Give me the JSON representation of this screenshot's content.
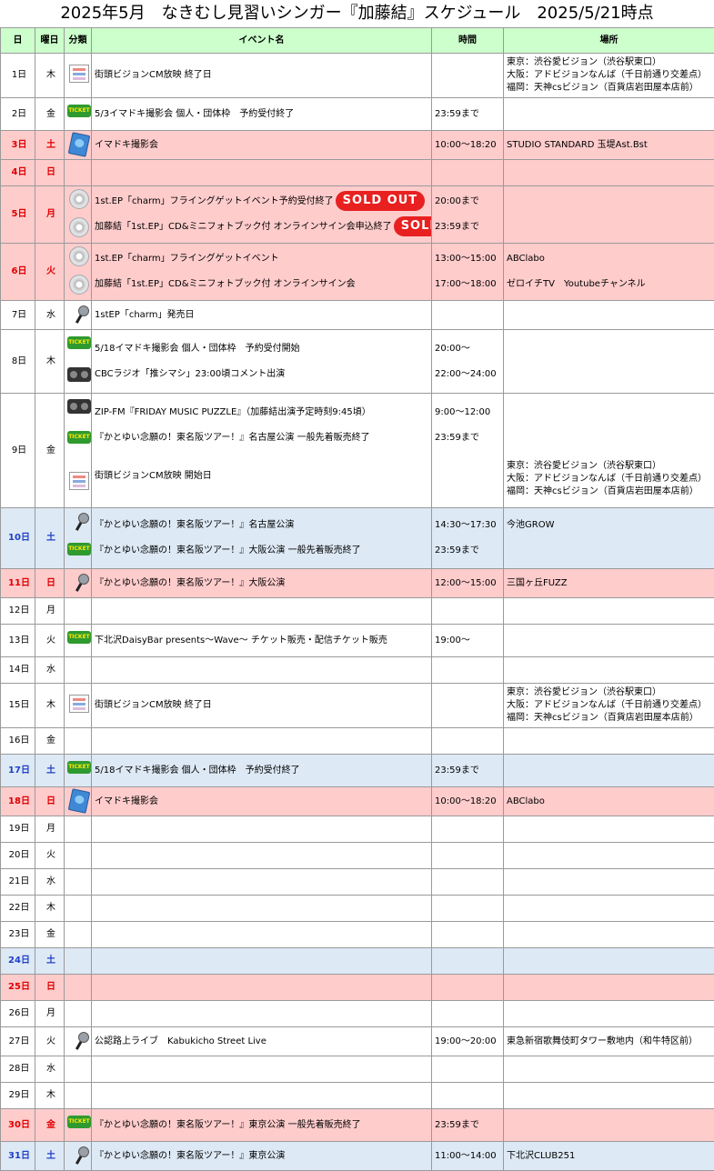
{
  "title": "2025年5月　なきむし見習いシンガー『加藤結』スケジュール　2025/5/21時点",
  "headers": {
    "day": "日",
    "weekday": "曜日",
    "category": "分類",
    "event": "イベント名",
    "time": "時間",
    "place": "場所"
  },
  "sold_out_label": "SOLD OUT",
  "colors": {
    "header": "#ccffcc",
    "saturday": "#dde9f5",
    "sunday": "#ffcccc",
    "saturday_text": "#1f3fc8",
    "sunday_text": "#e00000"
  },
  "rows": [
    {
      "day": "1日",
      "weekday": "木",
      "type": "",
      "events": [
        {
          "icon": "vision-icon",
          "name": "街頭ビジョンCM放映 終了日",
          "time": ""
        }
      ],
      "place": [
        "東京：渋谷愛ビジョン（渋谷駅東口）",
        "大阪：アドビジョンなんば（千日前通り交差点）",
        "福岡：天神csビジョン（百貨店岩田屋本店前）"
      ]
    },
    {
      "day": "2日",
      "weekday": "金",
      "type": "",
      "events": [
        {
          "icon": "ticket-icon",
          "name": "5/3イマドキ撮影会 個人・団体枠　予約受付終了",
          "time": "23:59まで"
        }
      ],
      "place": []
    },
    {
      "day": "3日",
      "weekday": "土",
      "type": "sun",
      "events": [
        {
          "icon": "camera-icon",
          "name": "イマドキ撮影会",
          "time": "10:00～18:20"
        }
      ],
      "place": [
        "STUDIO STANDARD 玉堤Ast.Bst"
      ]
    },
    {
      "day": "4日",
      "weekday": "日",
      "type": "sun",
      "events": [
        {
          "icon": "",
          "name": "",
          "time": ""
        }
      ],
      "place": []
    },
    {
      "day": "5日",
      "weekday": "月",
      "type": "sun",
      "events": [
        {
          "icon": "cd-icon",
          "name": "1st.EP「charm」フライングゲットイベント予約受付終了",
          "time": "20:00まで",
          "sold_out": true
        },
        {
          "icon": "cd-icon",
          "name": "加藤結「1st.EP」CD&ミニフォトブック付 オンラインサイン会申込終了",
          "time": "23:59まで",
          "sold_out": true
        }
      ],
      "place": []
    },
    {
      "day": "6日",
      "weekday": "火",
      "type": "sun",
      "events": [
        {
          "icon": "cd-icon",
          "name": "1st.EP「charm」フライングゲットイベント",
          "time": "13:00～15:00",
          "place": "ABClabo"
        },
        {
          "icon": "cd-icon",
          "name": "加藤結「1st.EP」CD&ミニフォトブック付 オンラインサイン会",
          "time": "17:00～18:00",
          "place": "ゼロイチTV　Youtubeチャンネル"
        }
      ],
      "place": []
    },
    {
      "day": "7日",
      "weekday": "水",
      "type": "",
      "events": [
        {
          "icon": "mic-icon",
          "name": "1stEP「charm」発売日",
          "time": ""
        }
      ],
      "place": []
    },
    {
      "day": "8日",
      "weekday": "木",
      "type": "",
      "events": [
        {
          "icon": "ticket-icon",
          "name": "5/18イマドキ撮影会 個人・団体枠　予約受付開始",
          "time": "20:00～"
        },
        {
          "icon": "radio-icon",
          "name": "CBCラジオ「推シマシ」23:00頃コメント出演",
          "time": "22:00～24:00"
        }
      ],
      "place": []
    },
    {
      "day": "9日",
      "weekday": "金",
      "type": "",
      "events": [
        {
          "icon": "radio-icon",
          "name": "ZIP-FM『FRIDAY MUSIC PUZZLE』（加藤結出演予定時刻9:45頃）",
          "time": "9:00～12:00"
        },
        {
          "icon": "ticket-icon",
          "name": "『かとゆい念願の！東名阪ツアー！』名古屋公演 一般先着販売終了",
          "time": "23:59まで"
        },
        {
          "icon": "vision-icon",
          "name": "街頭ビジョンCM放映 開始日",
          "time": "",
          "tall": true,
          "places": [
            "東京：渋谷愛ビジョン（渋谷駅東口）",
            "大阪：アドビジョンなんば（千日前通り交差点）",
            "福岡：天神csビジョン（百貨店岩田屋本店前）"
          ]
        }
      ],
      "place": []
    },
    {
      "day": "10日",
      "weekday": "土",
      "type": "sat",
      "events": [
        {
          "icon": "mic-icon",
          "name": "『かとゆい念願の！東名阪ツアー！』名古屋公演",
          "time": "14:30～17:30",
          "place": "今池GROW"
        },
        {
          "icon": "ticket-icon",
          "name": "『かとゆい念願の！東名阪ツアー！』大阪公演 一般先着販売終了",
          "time": "23:59まで"
        }
      ],
      "place": []
    },
    {
      "day": "11日",
      "weekday": "日",
      "type": "sun",
      "events": [
        {
          "icon": "mic-icon",
          "name": "『かとゆい念願の！東名阪ツアー！』大阪公演",
          "time": "12:00～15:00"
        }
      ],
      "place": [
        "三国ヶ丘FUZZ"
      ]
    },
    {
      "day": "12日",
      "weekday": "月",
      "type": "",
      "events": [
        {
          "icon": "",
          "name": "",
          "time": ""
        }
      ],
      "place": []
    },
    {
      "day": "13日",
      "weekday": "火",
      "type": "",
      "events": [
        {
          "icon": "ticket-icon",
          "name": "下北沢DaisyBar presents～Wave～ チケット販売・配信チケット販売",
          "time": "19:00～"
        }
      ],
      "place": []
    },
    {
      "day": "14日",
      "weekday": "水",
      "type": "",
      "events": [
        {
          "icon": "",
          "name": "",
          "time": ""
        }
      ],
      "place": []
    },
    {
      "day": "15日",
      "weekday": "木",
      "type": "",
      "events": [
        {
          "icon": "vision-icon",
          "name": "街頭ビジョンCM放映 終了日",
          "time": ""
        }
      ],
      "place": [
        "東京：渋谷愛ビジョン（渋谷駅東口）",
        "大阪：アドビジョンなんば（千日前通り交差点）",
        "福岡：天神csビジョン（百貨店岩田屋本店前）"
      ]
    },
    {
      "day": "16日",
      "weekday": "金",
      "type": "",
      "events": [
        {
          "icon": "",
          "name": "",
          "time": ""
        }
      ],
      "place": []
    },
    {
      "day": "17日",
      "weekday": "土",
      "type": "sat",
      "events": [
        {
          "icon": "ticket-icon",
          "name": "5/18イマドキ撮影会 個人・団体枠　予約受付終了",
          "time": "23:59まで"
        }
      ],
      "place": []
    },
    {
      "day": "18日",
      "weekday": "日",
      "type": "sun",
      "events": [
        {
          "icon": "camera-icon",
          "name": "イマドキ撮影会",
          "time": "10:00～18:20"
        }
      ],
      "place": [
        "ABClabo"
      ]
    },
    {
      "day": "19日",
      "weekday": "月",
      "type": "",
      "events": [
        {
          "icon": "",
          "name": "",
          "time": ""
        }
      ],
      "place": []
    },
    {
      "day": "20日",
      "weekday": "火",
      "type": "",
      "events": [
        {
          "icon": "",
          "name": "",
          "time": ""
        }
      ],
      "place": []
    },
    {
      "day": "21日",
      "weekday": "水",
      "type": "",
      "events": [
        {
          "icon": "",
          "name": "",
          "time": ""
        }
      ],
      "place": []
    },
    {
      "day": "22日",
      "weekday": "木",
      "type": "",
      "events": [
        {
          "icon": "",
          "name": "",
          "time": ""
        }
      ],
      "place": []
    },
    {
      "day": "23日",
      "weekday": "金",
      "type": "",
      "events": [
        {
          "icon": "",
          "name": "",
          "time": ""
        }
      ],
      "place": []
    },
    {
      "day": "24日",
      "weekday": "土",
      "type": "sat",
      "events": [
        {
          "icon": "",
          "name": "",
          "time": ""
        }
      ],
      "place": []
    },
    {
      "day": "25日",
      "weekday": "日",
      "type": "sun",
      "events": [
        {
          "icon": "",
          "name": "",
          "time": ""
        }
      ],
      "place": []
    },
    {
      "day": "26日",
      "weekday": "月",
      "type": "",
      "events": [
        {
          "icon": "",
          "name": "",
          "time": ""
        }
      ],
      "place": []
    },
    {
      "day": "27日",
      "weekday": "火",
      "type": "",
      "events": [
        {
          "icon": "mic-icon",
          "name": "公認路上ライブ　Kabukicho Street Live",
          "time": "19:00～20:00"
        }
      ],
      "place": [
        "東急新宿歌舞伎町タワー敷地内（和牛特区前）"
      ]
    },
    {
      "day": "28日",
      "weekday": "水",
      "type": "",
      "events": [
        {
          "icon": "",
          "name": "",
          "time": ""
        }
      ],
      "place": []
    },
    {
      "day": "29日",
      "weekday": "木",
      "type": "",
      "events": [
        {
          "icon": "",
          "name": "",
          "time": ""
        }
      ],
      "place": []
    },
    {
      "day": "30日",
      "weekday": "金",
      "type": "sun",
      "events": [
        {
          "icon": "ticket-icon",
          "name": "『かとゆい念願の！東名阪ツアー！』東京公演 一般先着販売終了",
          "time": "23:59まで"
        }
      ],
      "place": []
    },
    {
      "day": "31日",
      "weekday": "土",
      "type": "sat",
      "events": [
        {
          "icon": "mic-icon",
          "name": "『かとゆい念願の！東名阪ツアー！』東京公演",
          "time": "11:00～14:00"
        }
      ],
      "place": [
        "下北沢CLUB251"
      ]
    }
  ]
}
